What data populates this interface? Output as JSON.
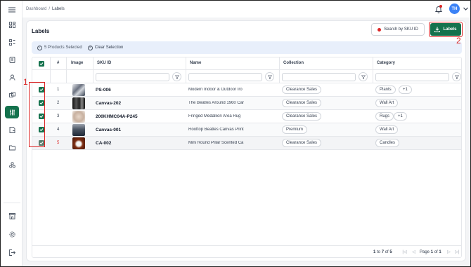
{
  "breadcrumb": {
    "root": "Dashboard",
    "separator": "/",
    "current": "Labels"
  },
  "user": {
    "initials": "TH"
  },
  "page": {
    "title": "Labels"
  },
  "actions": {
    "search_sku": "Search by SKU ID",
    "labels": "Labels"
  },
  "selection": {
    "count_text": "5 Products Selected",
    "clear": "Clear Selection"
  },
  "table": {
    "headers": {
      "num": "#",
      "image": "Image",
      "sku": "SKU ID",
      "name": "Name",
      "collection": "Collection",
      "category": "Category"
    },
    "rows": [
      {
        "num": "1",
        "sku": "PS-006",
        "name": "Modern Indoor & Outdoor Iro",
        "collection": "Clearance Sales",
        "category": "Plants",
        "extra": "+1"
      },
      {
        "num": "2",
        "sku": "Canvas-202",
        "name": "The Beatles Around 1960 Car",
        "collection": "Clearance Sales",
        "category": "Wall Art",
        "extra": ""
      },
      {
        "num": "3",
        "sku": "200KHMC04A-P245",
        "name": "Fringed Medallion Area Rug",
        "collection": "Clearance Sales",
        "category": "Rugs",
        "extra": "+1"
      },
      {
        "num": "4",
        "sku": "Canvas-001",
        "name": "Rooftop Beatles Canvas Print",
        "collection": "Premium",
        "category": "Wall Art",
        "extra": ""
      },
      {
        "num": "5",
        "sku": "CA-002",
        "name": "Mini Round Pillar Scented Ca",
        "collection": "Clearance Sales",
        "category": "Candles",
        "extra": ""
      }
    ]
  },
  "pagination": {
    "from": "1",
    "to_word": "to",
    "to": "7",
    "of_word": "of",
    "total": "5",
    "page_word": "Page",
    "page": "1",
    "pages": "1"
  },
  "annotations": {
    "one": "1",
    "two": "2"
  },
  "colors": {
    "accent": "#14724d",
    "highlight": "#dc2626",
    "selbar": "#e8effb",
    "avatar": "#3b82f6"
  }
}
